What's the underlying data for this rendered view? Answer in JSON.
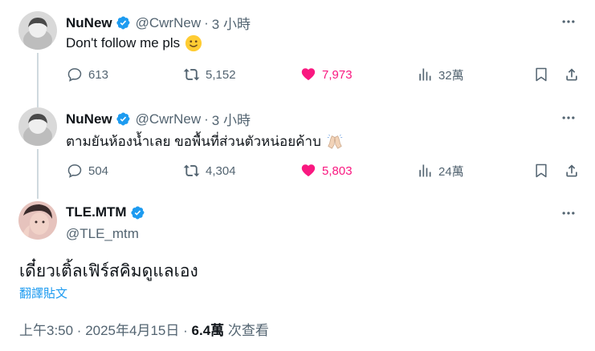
{
  "tweets": [
    {
      "name": "NuNew",
      "handle": "@CwrNew",
      "time": "3 小時",
      "text": "Don't follow me pls",
      "emoji": "slightly-smiling-face",
      "replies": "613",
      "reposts": "5,152",
      "likes": "7,973",
      "views": "32萬"
    },
    {
      "name": "NuNew",
      "handle": "@CwrNew",
      "time": "3 小時",
      "text": "ตามยันห้องน้ำเลย ขอพื้นที่ส่วนตัวหน่อยค้าบ",
      "emoji": "folded-hands",
      "replies": "504",
      "reposts": "4,304",
      "likes": "5,803",
      "views": "24萬"
    }
  ],
  "main": {
    "name": "TLE.MTM",
    "handle": "@TLE_mtm",
    "text": "เดี๋ยวเติ้ลเฟิร์สคิมดูแลเอง",
    "translate": "翻譯貼文",
    "timestamp": "上午3:50 · 2025年4月15日",
    "views_count": "6.4萬",
    "views_label": "次查看"
  },
  "colors": {
    "like": "#f91880",
    "verified": "#1d9bf0",
    "muted": "#536471",
    "link": "#1d9bf0"
  },
  "icons": [
    "reply-icon",
    "repost-icon",
    "like-icon",
    "views-icon",
    "bookmark-icon",
    "share-icon",
    "more-icon",
    "verified-badge-icon"
  ]
}
